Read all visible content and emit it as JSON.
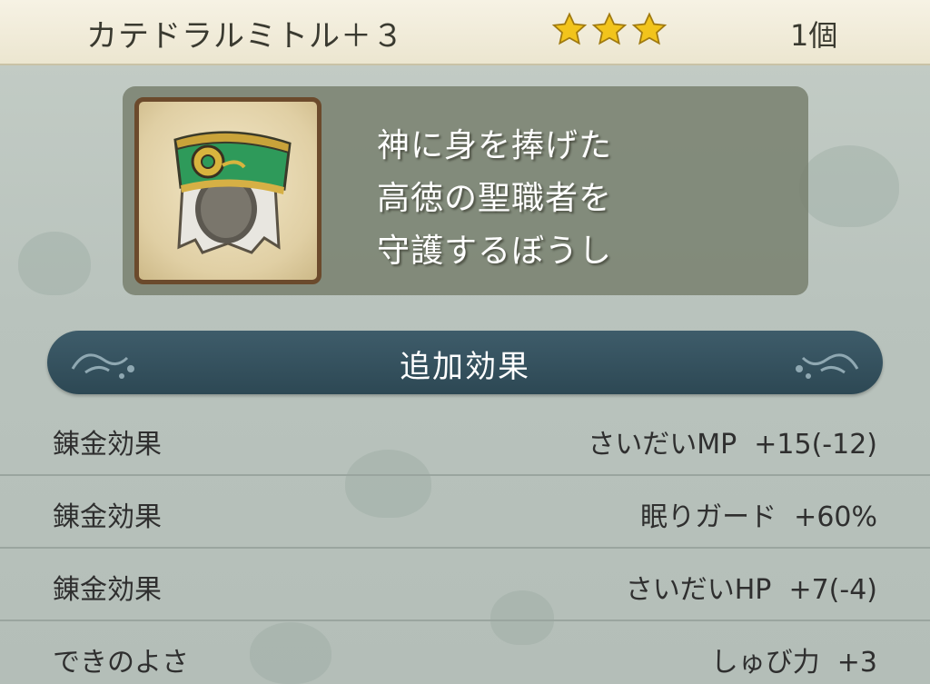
{
  "header": {
    "item_name": "カテドラルミトル＋３",
    "stars": 3,
    "count": "1個"
  },
  "item": {
    "icon": "green-mitre-hat-icon",
    "description_lines": [
      "神に身を捧げた",
      "高徳の聖職者を",
      "守護するぼうし"
    ]
  },
  "section": {
    "title": "追加効果"
  },
  "effects": [
    {
      "label": "錬金効果",
      "value": "さいだいMP  +15(-12)"
    },
    {
      "label": "錬金効果",
      "value": "眠りガード  +60%"
    },
    {
      "label": "錬金効果",
      "value": "さいだいHP  +7(-4)"
    },
    {
      "label": "できのよさ",
      "value": "しゅび力  +3"
    }
  ],
  "colors": {
    "star": "#f2c41c",
    "banner": "#34505d",
    "hat_green": "#2e9a5a",
    "frame": "#6b4a2c"
  }
}
